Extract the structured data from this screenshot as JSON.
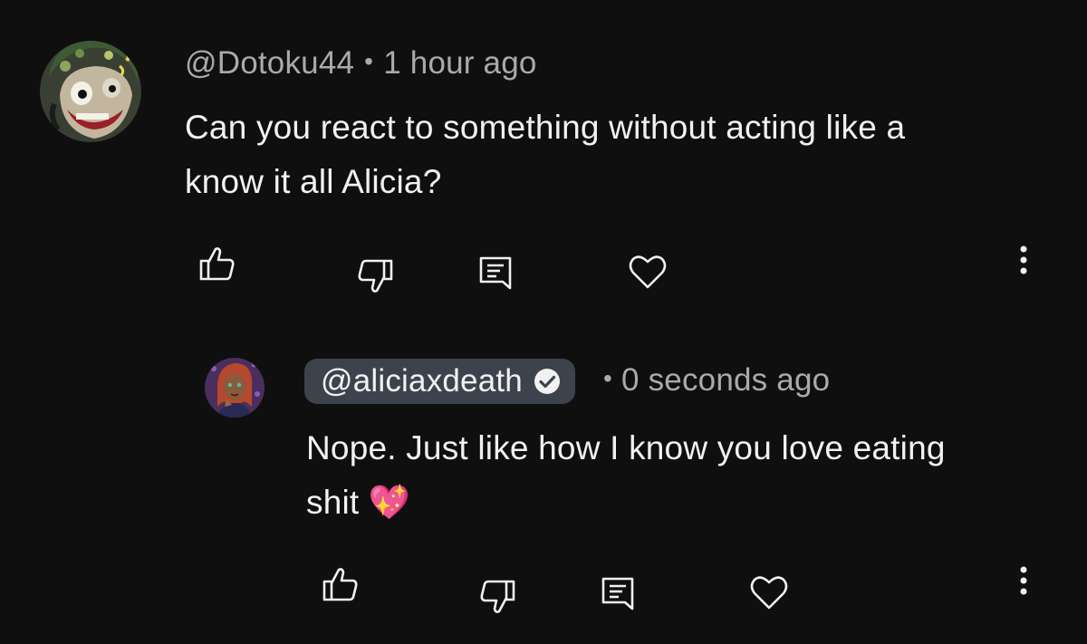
{
  "comment": {
    "author": "@Dotoku44",
    "separator": "•",
    "time": "1 hour ago",
    "text_line1": "Can you react to something without acting like a",
    "text_line2": "know it all Alicia?"
  },
  "reply": {
    "author": "@aliciaxdeath",
    "separator": "•",
    "time": "0 seconds ago",
    "text_line1": "Nope. Just like how I know you love eating",
    "text_line2": "shit 💖"
  },
  "icons": {
    "like": "thumbs-up-icon",
    "dislike": "thumbs-down-icon",
    "reply": "reply-icon",
    "heart": "heart-icon",
    "more": "more-vertical-icon",
    "verified": "verified-check-icon"
  },
  "colors": {
    "background": "#0f0f0f",
    "primary_text": "#f1f1f1",
    "secondary_text": "#aaaaaa",
    "creator_badge": "#3d434d"
  }
}
